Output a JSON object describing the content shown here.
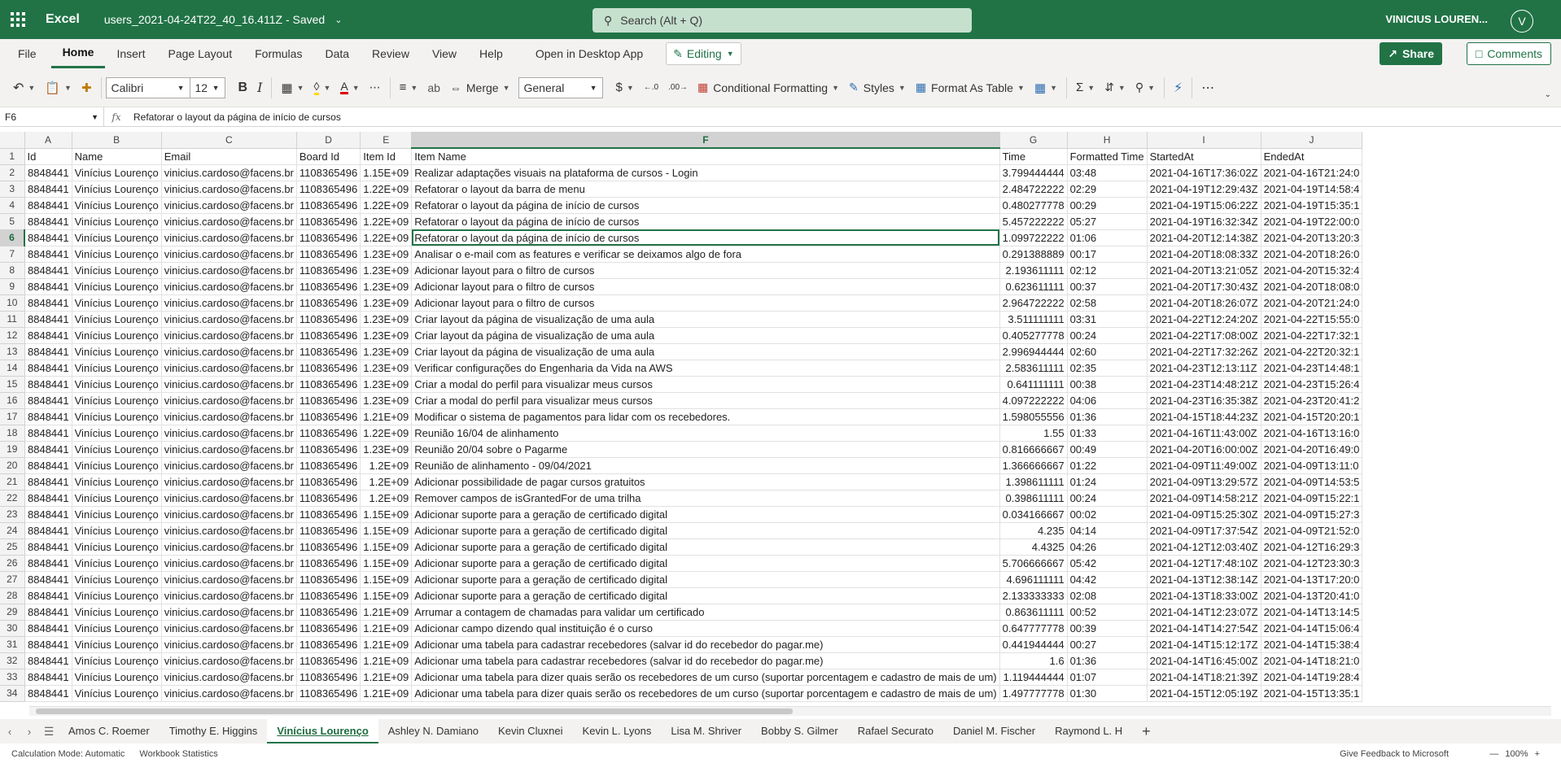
{
  "titlebar": {
    "app_name": "Excel",
    "doc_name": "users_2021-04-24T22_40_16.411Z - Saved",
    "search_placeholder": "Search (Alt + Q)",
    "user_name": "VINICIUS LOUREN...",
    "avatar_initial": "V"
  },
  "menu": {
    "items": [
      "File",
      "Home",
      "Insert",
      "Page Layout",
      "Formulas",
      "Data",
      "Review",
      "View",
      "Help"
    ],
    "open_desktop": "Open in Desktop App",
    "editing": "Editing",
    "share": "Share",
    "comments": "Comments"
  },
  "ribbon": {
    "font_name": "Calibri",
    "font_size": "12",
    "merge": "Merge",
    "number_format": "General",
    "conditional_formatting": "Conditional Formatting",
    "styles": "Styles",
    "format_as_table": "Format As Table"
  },
  "formula_bar": {
    "cell_ref": "F6",
    "fx": "fx",
    "content": "Refatorar o layout da página de início de cursos"
  },
  "grid": {
    "columns": [
      "A",
      "B",
      "C",
      "D",
      "E",
      "F",
      "G",
      "H",
      "I",
      "J"
    ],
    "header_row": [
      "Id",
      "Name",
      "Email",
      "Board Id",
      "Item Id",
      "Item Name",
      "Time",
      "Formatted Time",
      "StartedAt",
      "EndedAt"
    ],
    "rows": [
      [
        "8848441",
        "Vinícius Lourenço",
        "vinicius.cardoso@facens.br",
        "1108365496",
        "1.15E+09",
        "Realizar adaptações visuais na plataforma de cursos - Login",
        "3.799444444",
        "03:48",
        "2021-04-16T17:36:02Z",
        "2021-04-16T21:24:0"
      ],
      [
        "8848441",
        "Vinícius Lourenço",
        "vinicius.cardoso@facens.br",
        "1108365496",
        "1.22E+09",
        "Refatorar o layout da barra de menu",
        "2.484722222",
        "02:29",
        "2021-04-19T12:29:43Z",
        "2021-04-19T14:58:4"
      ],
      [
        "8848441",
        "Vinícius Lourenço",
        "vinicius.cardoso@facens.br",
        "1108365496",
        "1.22E+09",
        "Refatorar o layout da página de início de cursos",
        "0.480277778",
        "00:29",
        "2021-04-19T15:06:22Z",
        "2021-04-19T15:35:1"
      ],
      [
        "8848441",
        "Vinícius Lourenço",
        "vinicius.cardoso@facens.br",
        "1108365496",
        "1.22E+09",
        "Refatorar o layout da página de início de cursos",
        "5.457222222",
        "05:27",
        "2021-04-19T16:32:34Z",
        "2021-04-19T22:00:0"
      ],
      [
        "8848441",
        "Vinícius Lourenço",
        "vinicius.cardoso@facens.br",
        "1108365496",
        "1.22E+09",
        "Refatorar o layout da página de início de cursos",
        "1.099722222",
        "01:06",
        "2021-04-20T12:14:38Z",
        "2021-04-20T13:20:3"
      ],
      [
        "8848441",
        "Vinícius Lourenço",
        "vinicius.cardoso@facens.br",
        "1108365496",
        "1.23E+09",
        "Analisar o e-mail com as features e verificar se deixamos algo de fora",
        "0.291388889",
        "00:17",
        "2021-04-20T18:08:33Z",
        "2021-04-20T18:26:0"
      ],
      [
        "8848441",
        "Vinícius Lourenço",
        "vinicius.cardoso@facens.br",
        "1108365496",
        "1.23E+09",
        "Adicionar layout para o filtro de cursos",
        "2.193611111",
        "02:12",
        "2021-04-20T13:21:05Z",
        "2021-04-20T15:32:4"
      ],
      [
        "8848441",
        "Vinícius Lourenço",
        "vinicius.cardoso@facens.br",
        "1108365496",
        "1.23E+09",
        "Adicionar layout para o filtro de cursos",
        "0.623611111",
        "00:37",
        "2021-04-20T17:30:43Z",
        "2021-04-20T18:08:0"
      ],
      [
        "8848441",
        "Vinícius Lourenço",
        "vinicius.cardoso@facens.br",
        "1108365496",
        "1.23E+09",
        "Adicionar layout para o filtro de cursos",
        "2.964722222",
        "02:58",
        "2021-04-20T18:26:07Z",
        "2021-04-20T21:24:0"
      ],
      [
        "8848441",
        "Vinícius Lourenço",
        "vinicius.cardoso@facens.br",
        "1108365496",
        "1.23E+09",
        "Criar layout da página de visualização de uma aula",
        "3.511111111",
        "03:31",
        "2021-04-22T12:24:20Z",
        "2021-04-22T15:55:0"
      ],
      [
        "8848441",
        "Vinícius Lourenço",
        "vinicius.cardoso@facens.br",
        "1108365496",
        "1.23E+09",
        "Criar layout da página de visualização de uma aula",
        "0.405277778",
        "00:24",
        "2021-04-22T17:08:00Z",
        "2021-04-22T17:32:1"
      ],
      [
        "8848441",
        "Vinícius Lourenço",
        "vinicius.cardoso@facens.br",
        "1108365496",
        "1.23E+09",
        "Criar layout da página de visualização de uma aula",
        "2.996944444",
        "02:60",
        "2021-04-22T17:32:26Z",
        "2021-04-22T20:32:1"
      ],
      [
        "8848441",
        "Vinícius Lourenço",
        "vinicius.cardoso@facens.br",
        "1108365496",
        "1.23E+09",
        "Verificar configurações do Engenharia da Vida na AWS",
        "2.583611111",
        "02:35",
        "2021-04-23T12:13:11Z",
        "2021-04-23T14:48:1"
      ],
      [
        "8848441",
        "Vinícius Lourenço",
        "vinicius.cardoso@facens.br",
        "1108365496",
        "1.23E+09",
        "Criar a modal do perfil para visualizar meus cursos",
        "0.641111111",
        "00:38",
        "2021-04-23T14:48:21Z",
        "2021-04-23T15:26:4"
      ],
      [
        "8848441",
        "Vinícius Lourenço",
        "vinicius.cardoso@facens.br",
        "1108365496",
        "1.23E+09",
        "Criar a modal do perfil para visualizar meus cursos",
        "4.097222222",
        "04:06",
        "2021-04-23T16:35:38Z",
        "2021-04-23T20:41:2"
      ],
      [
        "8848441",
        "Vinícius Lourenço",
        "vinicius.cardoso@facens.br",
        "1108365496",
        "1.21E+09",
        "Modificar o sistema de pagamentos para lidar com os recebedores.",
        "1.598055556",
        "01:36",
        "2021-04-15T18:44:23Z",
        "2021-04-15T20:20:1"
      ],
      [
        "8848441",
        "Vinícius Lourenço",
        "vinicius.cardoso@facens.br",
        "1108365496",
        "1.22E+09",
        "Reunião 16/04 de alinhamento",
        "1.55",
        "01:33",
        "2021-04-16T11:43:00Z",
        "2021-04-16T13:16:0"
      ],
      [
        "8848441",
        "Vinícius Lourenço",
        "vinicius.cardoso@facens.br",
        "1108365496",
        "1.23E+09",
        "Reunião 20/04 sobre o Pagarme",
        "0.816666667",
        "00:49",
        "2021-04-20T16:00:00Z",
        "2021-04-20T16:49:0"
      ],
      [
        "8848441",
        "Vinícius Lourenço",
        "vinicius.cardoso@facens.br",
        "1108365496",
        "1.2E+09",
        "Reunião de alinhamento - 09/04/2021",
        "1.366666667",
        "01:22",
        "2021-04-09T11:49:00Z",
        "2021-04-09T13:11:0"
      ],
      [
        "8848441",
        "Vinícius Lourenço",
        "vinicius.cardoso@facens.br",
        "1108365496",
        "1.2E+09",
        "Adicionar possibilidade de pagar cursos gratuitos",
        "1.398611111",
        "01:24",
        "2021-04-09T13:29:57Z",
        "2021-04-09T14:53:5"
      ],
      [
        "8848441",
        "Vinícius Lourenço",
        "vinicius.cardoso@facens.br",
        "1108365496",
        "1.2E+09",
        "Remover campos de isGrantedFor de uma trilha",
        "0.398611111",
        "00:24",
        "2021-04-09T14:58:21Z",
        "2021-04-09T15:22:1"
      ],
      [
        "8848441",
        "Vinícius Lourenço",
        "vinicius.cardoso@facens.br",
        "1108365496",
        "1.15E+09",
        "Adicionar suporte para a geração de certificado digital",
        "0.034166667",
        "00:02",
        "2021-04-09T15:25:30Z",
        "2021-04-09T15:27:3"
      ],
      [
        "8848441",
        "Vinícius Lourenço",
        "vinicius.cardoso@facens.br",
        "1108365496",
        "1.15E+09",
        "Adicionar suporte para a geração de certificado digital",
        "4.235",
        "04:14",
        "2021-04-09T17:37:54Z",
        "2021-04-09T21:52:0"
      ],
      [
        "8848441",
        "Vinícius Lourenço",
        "vinicius.cardoso@facens.br",
        "1108365496",
        "1.15E+09",
        "Adicionar suporte para a geração de certificado digital",
        "4.4325",
        "04:26",
        "2021-04-12T12:03:40Z",
        "2021-04-12T16:29:3"
      ],
      [
        "8848441",
        "Vinícius Lourenço",
        "vinicius.cardoso@facens.br",
        "1108365496",
        "1.15E+09",
        "Adicionar suporte para a geração de certificado digital",
        "5.706666667",
        "05:42",
        "2021-04-12T17:48:10Z",
        "2021-04-12T23:30:3"
      ],
      [
        "8848441",
        "Vinícius Lourenço",
        "vinicius.cardoso@facens.br",
        "1108365496",
        "1.15E+09",
        "Adicionar suporte para a geração de certificado digital",
        "4.696111111",
        "04:42",
        "2021-04-13T12:38:14Z",
        "2021-04-13T17:20:0"
      ],
      [
        "8848441",
        "Vinícius Lourenço",
        "vinicius.cardoso@facens.br",
        "1108365496",
        "1.15E+09",
        "Adicionar suporte para a geração de certificado digital",
        "2.133333333",
        "02:08",
        "2021-04-13T18:33:00Z",
        "2021-04-13T20:41:0"
      ],
      [
        "8848441",
        "Vinícius Lourenço",
        "vinicius.cardoso@facens.br",
        "1108365496",
        "1.21E+09",
        "Arrumar a contagem de chamadas para validar um certificado",
        "0.863611111",
        "00:52",
        "2021-04-14T12:23:07Z",
        "2021-04-14T13:14:5"
      ],
      [
        "8848441",
        "Vinícius Lourenço",
        "vinicius.cardoso@facens.br",
        "1108365496",
        "1.21E+09",
        "Adicionar campo dizendo qual instituição é o curso",
        "0.647777778",
        "00:39",
        "2021-04-14T14:27:54Z",
        "2021-04-14T15:06:4"
      ],
      [
        "8848441",
        "Vinícius Lourenço",
        "vinicius.cardoso@facens.br",
        "1108365496",
        "1.21E+09",
        "Adicionar uma tabela para cadastrar recebedores (salvar id do recebedor do pagar.me)",
        "0.441944444",
        "00:27",
        "2021-04-14T15:12:17Z",
        "2021-04-14T15:38:4"
      ],
      [
        "8848441",
        "Vinícius Lourenço",
        "vinicius.cardoso@facens.br",
        "1108365496",
        "1.21E+09",
        "Adicionar uma tabela para cadastrar recebedores (salvar id do recebedor do pagar.me)",
        "1.6",
        "01:36",
        "2021-04-14T16:45:00Z",
        "2021-04-14T18:21:0"
      ],
      [
        "8848441",
        "Vinícius Lourenço",
        "vinicius.cardoso@facens.br",
        "1108365496",
        "1.21E+09",
        "Adicionar uma tabela para dizer quais serão os recebedores de um curso (suportar porcentagem e cadastro de mais de um)",
        "1.119444444",
        "01:07",
        "2021-04-14T18:21:39Z",
        "2021-04-14T19:28:4"
      ],
      [
        "8848441",
        "Vinícius Lourenço",
        "vinicius.cardoso@facens.br",
        "1108365496",
        "1.21E+09",
        "Adicionar uma tabela para dizer quais serão os recebedores de um curso (suportar porcentagem e cadastro de mais de um)",
        "1.497777778",
        "01:30",
        "2021-04-15T12:05:19Z",
        "2021-04-15T13:35:1"
      ]
    ]
  },
  "sheets": {
    "tabs": [
      "Amos C. Roemer",
      "Timothy E. Higgins",
      "Vinícius Lourenço",
      "Ashley N. Damiano",
      "Kevin Cluxnei",
      "Kevin L. Lyons",
      "Lisa M. Shriver",
      "Bobby S. Gilmer",
      "Rafael Securato",
      "Daniel M. Fischer",
      "Raymond L. H"
    ],
    "active": "Vinícius Lourenço"
  },
  "status": {
    "calc_mode": "Calculation Mode: Automatic",
    "workbook_stats": "Workbook Statistics",
    "feedback": "Give Feedback to Microsoft",
    "zoom": "100%"
  }
}
